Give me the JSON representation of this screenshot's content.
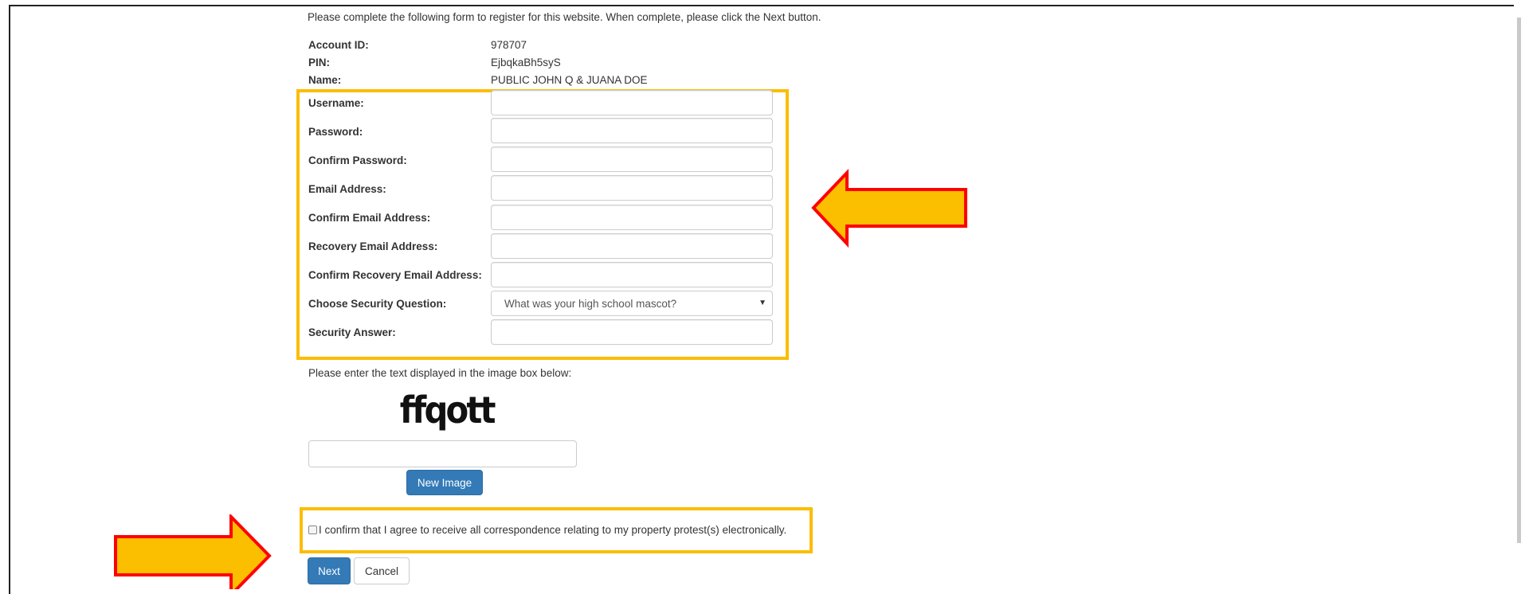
{
  "intro": "Please complete the following form to register for this website. When complete, please click the Next button.",
  "account": {
    "items": [
      {
        "label": "Account ID:",
        "value": "978707"
      },
      {
        "label": "PIN:",
        "value": "EjbqkaBh5syS"
      },
      {
        "label": "Name:",
        "value": "PUBLIC JOHN Q & JUANA DOE"
      }
    ]
  },
  "form": {
    "fields": [
      {
        "label": "Username:",
        "value": ""
      },
      {
        "label": "Password:",
        "value": ""
      },
      {
        "label": "Confirm Password:",
        "value": ""
      },
      {
        "label": "Email Address:",
        "value": ""
      },
      {
        "label": "Confirm Email Address:",
        "value": ""
      },
      {
        "label": "Recovery Email Address:",
        "value": ""
      },
      {
        "label": "Confirm Recovery Email Address:",
        "value": ""
      }
    ],
    "security_question": {
      "label": "Choose Security Question:",
      "selected": "What was your high school mascot?"
    },
    "security_answer": {
      "label": "Security Answer:",
      "value": ""
    }
  },
  "captcha": {
    "prompt": "Please enter the text displayed in the image box below:",
    "image_text": "ffqott",
    "input_value": "",
    "new_image_label": "New Image"
  },
  "consent": {
    "checked": false,
    "text": "I confirm that I agree to receive all correspondence relating to my property protest(s) electronically."
  },
  "actions": {
    "next_label": "Next",
    "cancel_label": "Cancel"
  },
  "colors": {
    "highlight_border": "#fbbd05",
    "arrow_fill": "#fcbf00",
    "arrow_stroke": "#ff0000",
    "primary": "#337ab7"
  }
}
